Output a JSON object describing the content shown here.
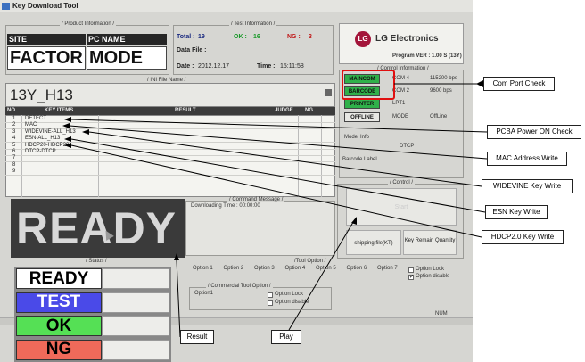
{
  "window": {
    "title": "Key Download Tool"
  },
  "product_info": {
    "group_label": "/ Product Information /",
    "site_label": "SITE",
    "pc_name_label": "PC NAME",
    "site_value": "FACTOR",
    "pc_name_value": "MODE"
  },
  "test_info": {
    "group_label": "/ Test Information /",
    "total_label": "Total :",
    "total_value": "19",
    "ok_label": "OK :",
    "ok_value": "16",
    "ng_label": "NG :",
    "ng_value": "3",
    "data_file_label": "Data File :",
    "date_label": "Date :",
    "date_value": "2012.12.17",
    "time_label": "Time :",
    "time_value": "15:11:58"
  },
  "brand": {
    "name": "LG Electronics",
    "logo_text": "LG",
    "program_ver": "Program VER : 1.00 S (13Y)"
  },
  "control_info": {
    "group_label": "/ Control Information /",
    "rows": [
      {
        "name": "MAINCOM",
        "port": "COM 4",
        "value": "115200 bps",
        "color": "#2fb04a"
      },
      {
        "name": "BARCODE",
        "port": "COM 2",
        "value": "9600 bps",
        "color": "#2fb04a"
      },
      {
        "name": "PRINTER",
        "port": "LPT1",
        "value": "",
        "color": "#2fb04a"
      },
      {
        "name": "OFFLINE",
        "port": "MODE",
        "value": "OffLine",
        "color": "#e8e8e4"
      }
    ],
    "model_info_label": "Model Info",
    "model_info_value": "DTCP",
    "barcode_label": "Barcode Label"
  },
  "ini_file": {
    "group_label": "/ INI File Name /",
    "value": "13Y_H13"
  },
  "key_table": {
    "headers": [
      "NO",
      "KEY ITEMS",
      "RESULT",
      "JUDGE",
      "NG"
    ],
    "rows": [
      {
        "no": "1",
        "item": "DETECT"
      },
      {
        "no": "2",
        "item": "MAC"
      },
      {
        "no": "3",
        "item": "WIDEVINE-ALL_H13"
      },
      {
        "no": "4",
        "item": "ESN-ALL_H13"
      },
      {
        "no": "5",
        "item": "HDCP20-HDCP20"
      },
      {
        "no": "6",
        "item": "DTCP-DTCP"
      },
      {
        "no": "7",
        "item": ""
      },
      {
        "no": "8",
        "item": ""
      },
      {
        "no": "9",
        "item": ""
      }
    ]
  },
  "command_message": {
    "group_label": "/ Command Message /",
    "text": "Downloading Time : 00:00:00"
  },
  "control": {
    "group_label": "/ Control /",
    "start_label": "Start",
    "shipping_label": "shipping file(KT)",
    "remain_label": "Key Remain Quantity"
  },
  "ready_display": "READY",
  "status_group_label": "/ Status /",
  "tool_option": {
    "group_label": "/Tool Option /",
    "options": [
      "Option 1",
      "Option 2",
      "Option 3",
      "Option 4",
      "Option 5",
      "Option 6",
      "Option 7"
    ],
    "option_lock": "Option Lock",
    "option_disable": "Option disable"
  },
  "commercial_tool_option": {
    "group_label": "/ Commercial Tool Option /",
    "option1": "Option1",
    "option_lock": "Option Lock",
    "option_disable": "Option disable"
  },
  "num_indicator": "NUM",
  "status_examples": [
    {
      "label": "READY",
      "bg": "#ffffff",
      "fg": "#000000"
    },
    {
      "label": "TEST",
      "bg": "#4a4ae8",
      "fg": "#ffffff"
    },
    {
      "label": "OK",
      "bg": "#55e055",
      "fg": "#000000"
    },
    {
      "label": "NG",
      "bg": "#f06a5a",
      "fg": "#000000"
    }
  ],
  "callouts": {
    "com_port": "Com Port Check",
    "pcba_power": "PCBA Power ON Check",
    "mac_address": "MAC Address Write",
    "widevine": "WIDEVINE Key Write",
    "esn": "ESN Key Write",
    "hdcp": "HDCP2.0 Key Write",
    "result": "Result",
    "play": "Play"
  }
}
